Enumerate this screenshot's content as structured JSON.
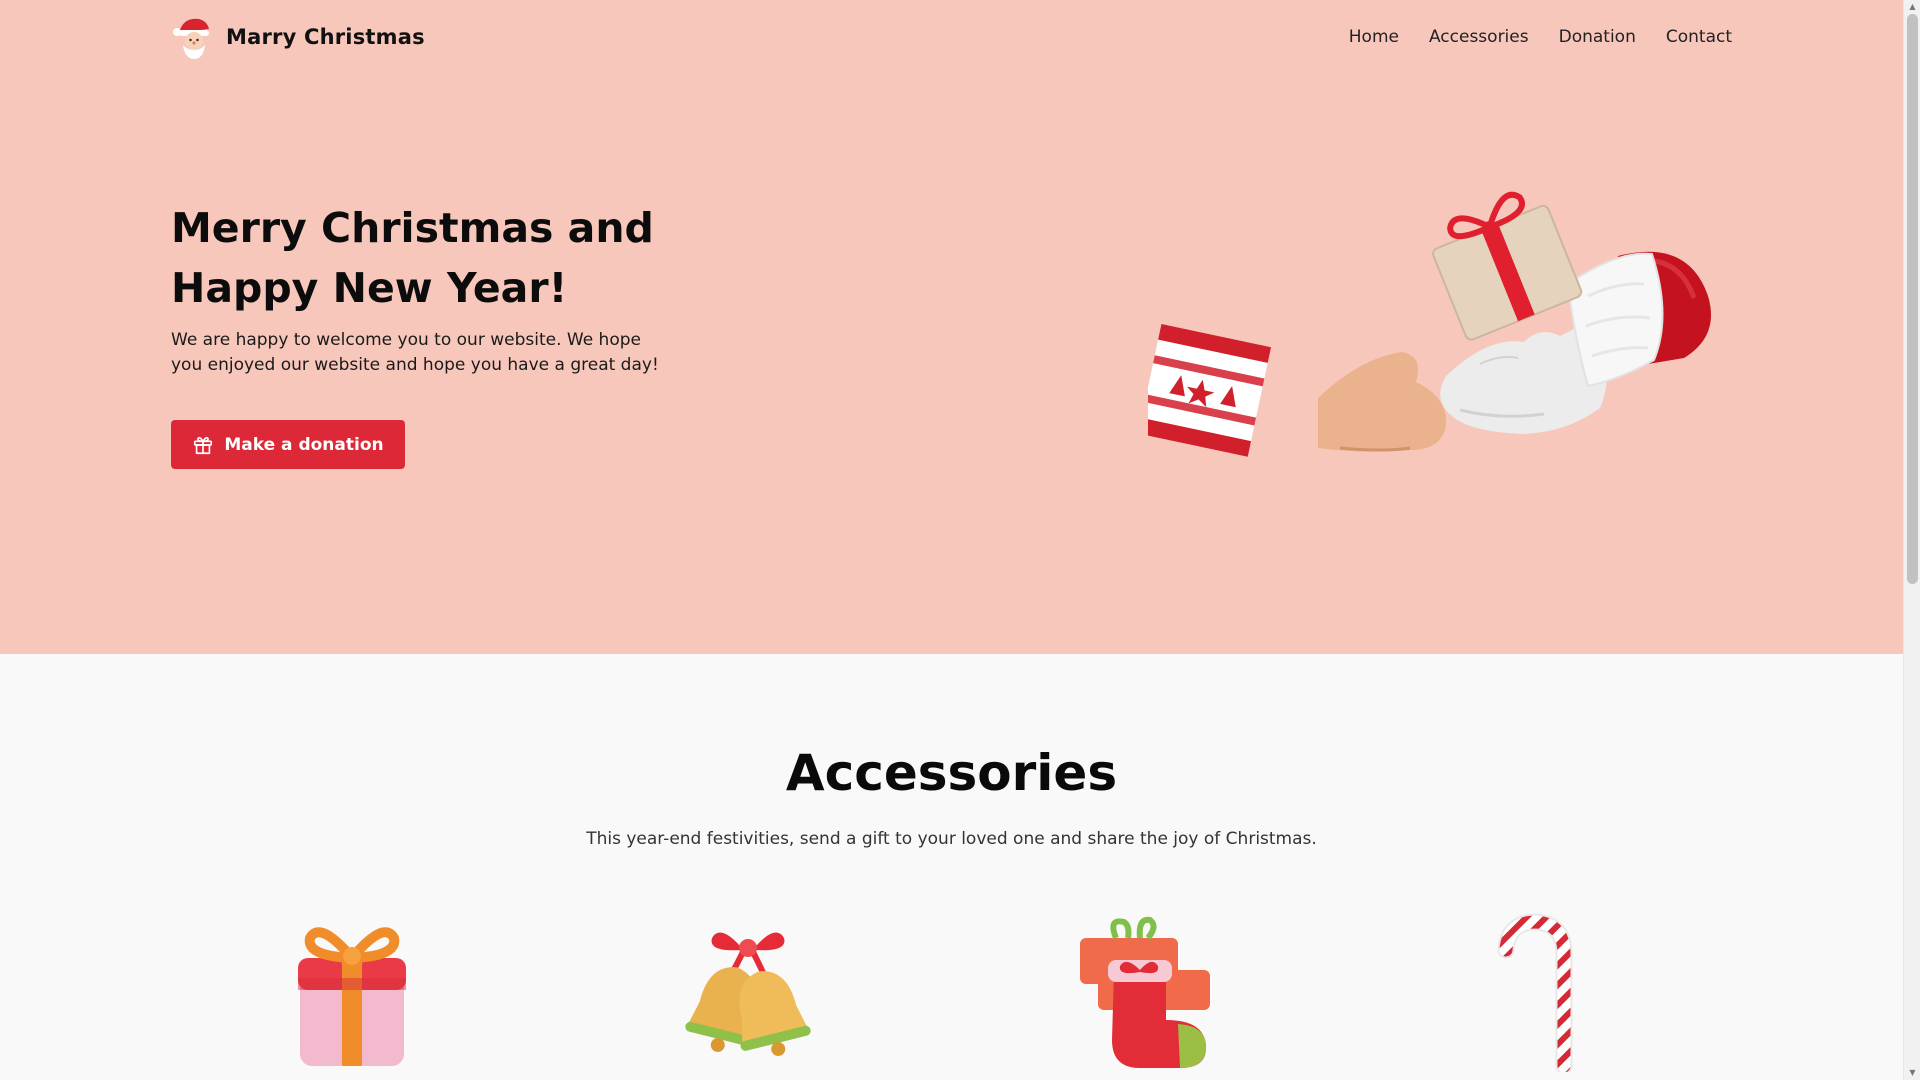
{
  "header": {
    "brand_name": "Marry Christmas",
    "logo_icon": "santa-icon",
    "nav": [
      {
        "label": "Home"
      },
      {
        "label": "Accessories"
      },
      {
        "label": "Donation"
      },
      {
        "label": "Contact"
      }
    ]
  },
  "hero": {
    "title": "Merry Christmas and Happy New Year!",
    "text": "We are happy to welcome you to our website. We hope you enjoyed our website and hope you have a great day!",
    "button_label": "Make a donation",
    "button_icon": "gift-icon",
    "illustration_icon": "gift-exchange-hands-icon"
  },
  "accessories": {
    "title": "Accessories",
    "subtitle": "This year-end festivities, send a gift to your loved one and share the joy of Christmas.",
    "items": [
      {
        "icon": "gift-box-icon"
      },
      {
        "icon": "jingle-bells-icon"
      },
      {
        "icon": "christmas-stocking-icon"
      },
      {
        "icon": "candy-cane-icon"
      }
    ]
  },
  "colors": {
    "hero_background": "#f8c7bb",
    "accent_red": "#dd2837",
    "page_background": "#f9f9f9"
  }
}
